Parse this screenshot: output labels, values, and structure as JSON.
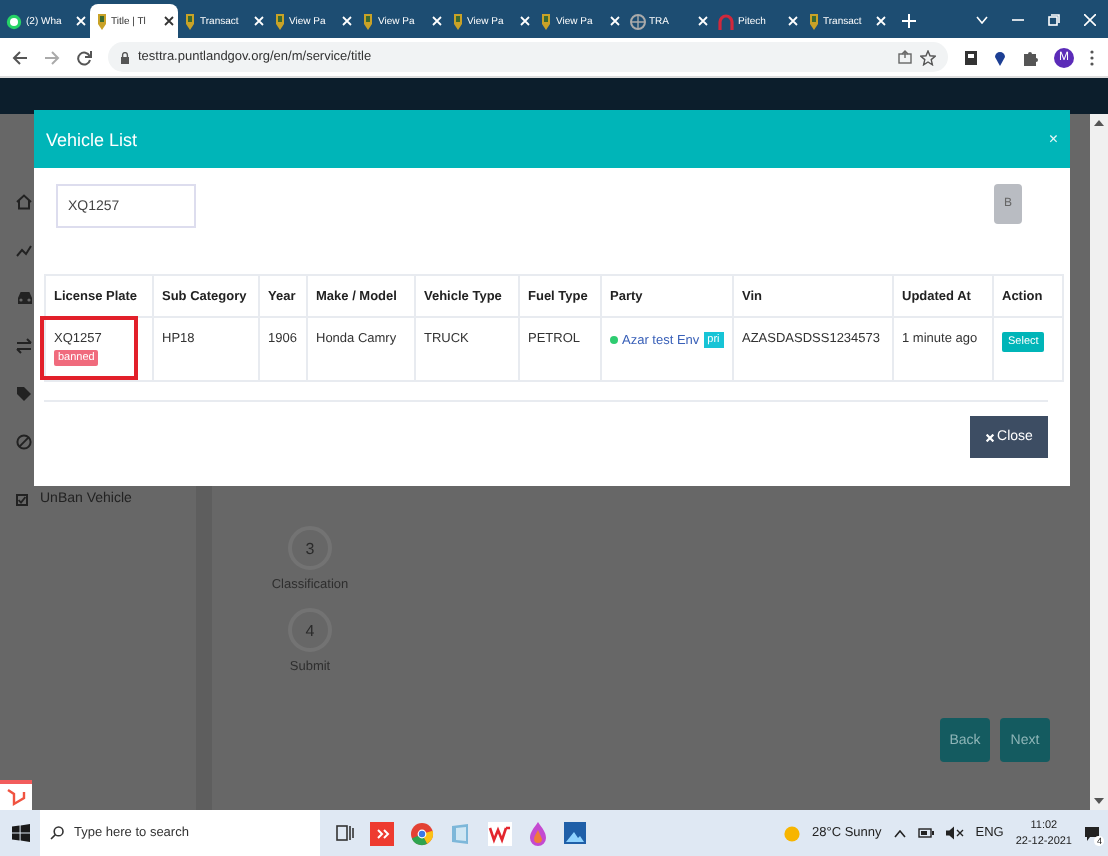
{
  "browser": {
    "tabs": [
      {
        "title": "(2) Wha",
        "kind": "chat",
        "selected": false
      },
      {
        "title": "Title | Tl",
        "kind": "crest",
        "selected": true
      },
      {
        "title": "Transact",
        "kind": "crest",
        "selected": false
      },
      {
        "title": "View Pa",
        "kind": "crest",
        "selected": false
      },
      {
        "title": "View Pa",
        "kind": "crest",
        "selected": false
      },
      {
        "title": "View Pa",
        "kind": "crest",
        "selected": false
      },
      {
        "title": "View Pa",
        "kind": "crest",
        "selected": false
      },
      {
        "title": "TRA",
        "kind": "globe",
        "selected": false
      },
      {
        "title": "Pitech",
        "kind": "arch",
        "selected": false
      },
      {
        "title": "Transact",
        "kind": "crest",
        "selected": false
      }
    ],
    "url": "testtra.puntlandgov.org/en/m/service/title",
    "avatar": "M"
  },
  "page": {
    "unban": {
      "label": "UnBan Vehicle",
      "checked": true
    },
    "steps": [
      {
        "number": "3",
        "label": "Classification"
      },
      {
        "number": "4",
        "label": "Submit"
      }
    ],
    "buttons": [
      "Back",
      "Next"
    ]
  },
  "modal": {
    "title": "Vehicle List",
    "close": "×",
    "search": {
      "value": "XQ1257"
    },
    "search_button": "B",
    "table": {
      "columns": [
        "License Plate",
        "Sub Category",
        "Year",
        "Make / Model",
        "Vehicle Type",
        "Fuel Type",
        "Party",
        "Vin",
        "Updated At",
        "Action"
      ],
      "rows": [
        {
          "license_plate": "XQ1257",
          "status": "banned",
          "highlighted": true,
          "sub_category": "HP18",
          "year": "1906",
          "make_model": "Honda Camry",
          "vehicle_type": "TRUCK",
          "fuel_type": "PETROL",
          "party": {
            "name": "Azar test Env",
            "badge": "pri",
            "color": "#2ecc71"
          },
          "vin": "AZASDASDSS1234573",
          "updated_at": "1 minute ago",
          "action": "Select"
        }
      ]
    },
    "close_button": "Close"
  },
  "taskbar": {
    "search_placeholder": "Type here to search",
    "weather": "28°C Sunny",
    "language": "ENG",
    "time": "11:02",
    "date": "22-12-2021",
    "notifications": "4"
  }
}
